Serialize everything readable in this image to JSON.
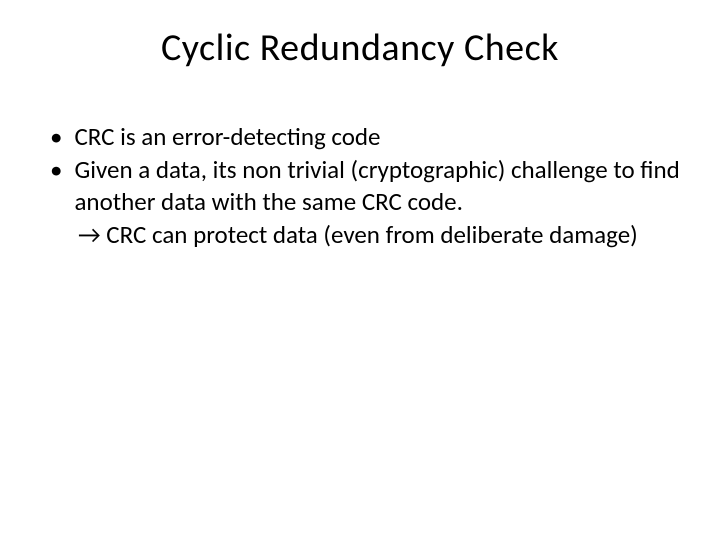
{
  "slide": {
    "title": "Cyclic Redundancy Check",
    "bullets": [
      {
        "text": "CRC is an error-detecting code"
      },
      {
        "text": "Given a data, its non trivial (cryptographic) challenge to find another data with the same CRC code.",
        "sub": "→ CRC can protect data (even from deliberate damage)"
      }
    ]
  }
}
